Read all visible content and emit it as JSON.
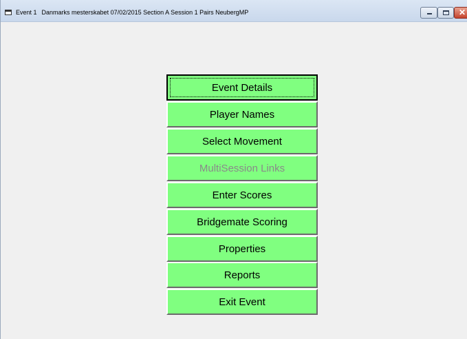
{
  "window": {
    "title_event": "Event 1",
    "title_details": "Danmarks mesterskabet 07/02/2015 Section A Session 1 Pairs NeubergMP",
    "minimize_glyph": "",
    "maximize_glyph": "",
    "close_glyph": "✕"
  },
  "menu": {
    "buttons": [
      {
        "label": "Event Details"
      },
      {
        "label": "Player Names"
      },
      {
        "label": "Select Movement"
      },
      {
        "label": "MultiSession Links"
      },
      {
        "label": "Enter Scores"
      },
      {
        "label": "Bridgemate Scoring"
      },
      {
        "label": "Properties"
      },
      {
        "label": "Reports"
      },
      {
        "label": "Exit Event"
      }
    ],
    "disabled_index": 3,
    "focused_index": 0
  },
  "colors": {
    "button_face": "#80ff80",
    "disabled_text": "#8a8a8a",
    "background": "#f0f0f0"
  }
}
